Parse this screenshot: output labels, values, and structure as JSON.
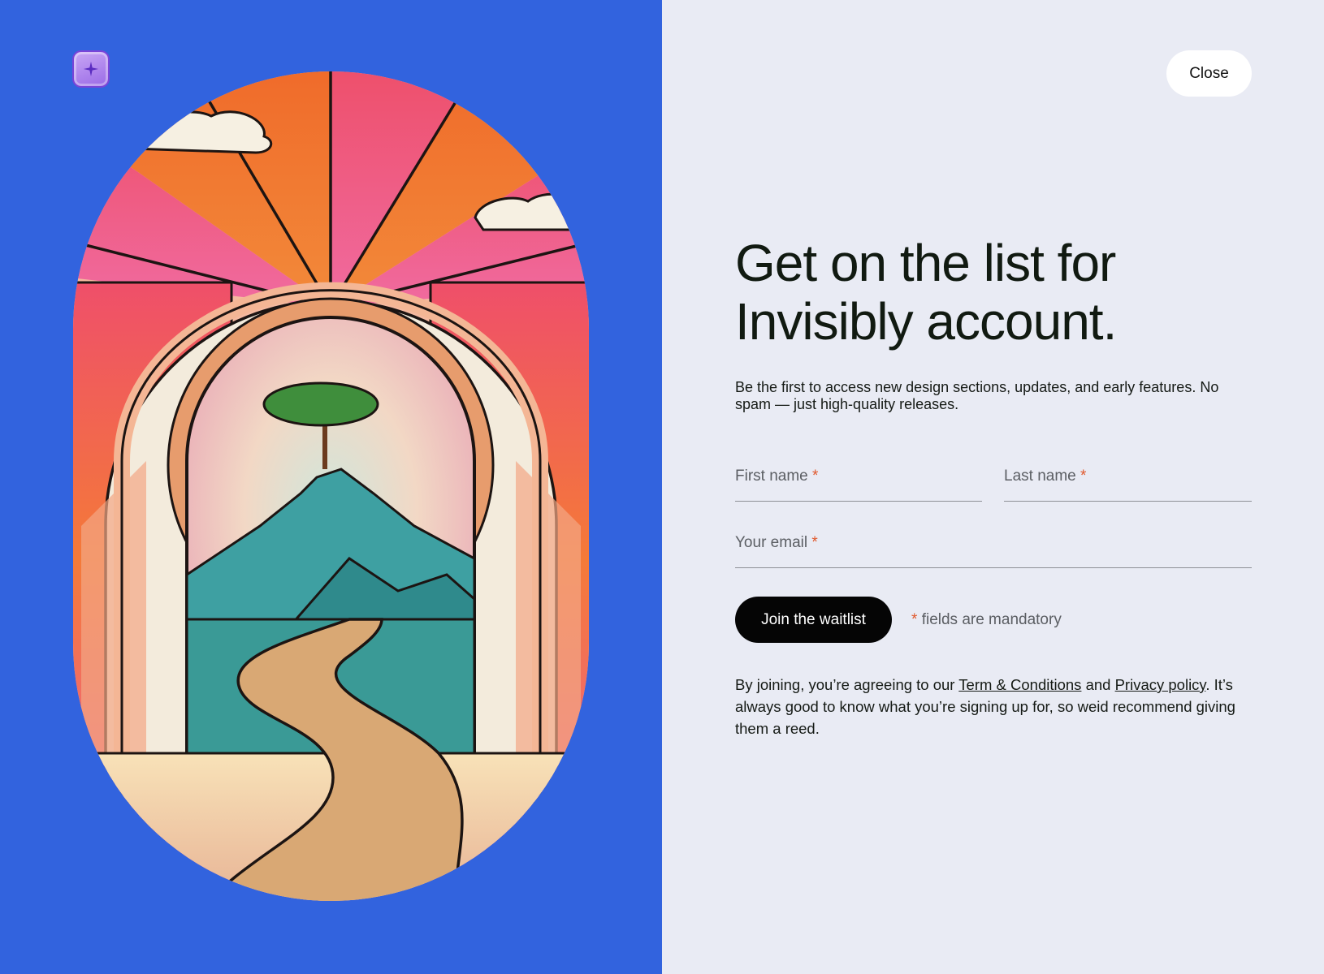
{
  "logo": {
    "icon": "sparkle-icon"
  },
  "header": {
    "close_label": "Close"
  },
  "main": {
    "headline_line1": "Get on the list for",
    "headline_line2": "Invisibly account.",
    "subheadline": "Be the first to access new design sections, updates, and early features. No spam — just high-quality releases."
  },
  "form": {
    "first_name_label": "First name",
    "last_name_label": "Last name",
    "email_label": "Your email",
    "required_marker": "*",
    "submit_label": "Join the waitlist",
    "mandatory_note": "fields are mandatory"
  },
  "legal": {
    "prefix": "By joining, you’re agreeing to our ",
    "terms_link": "Term & Conditions",
    "connector": " and ",
    "privacy_link": "Privacy policy",
    "suffix": ". It’s always good to know what you’re signing up for, so weid recommend giving them a reed."
  },
  "colors": {
    "left_bg": "#3263de",
    "right_bg": "#e9ebf4",
    "accent_required": "#e0582c",
    "button_bg": "#050505"
  }
}
